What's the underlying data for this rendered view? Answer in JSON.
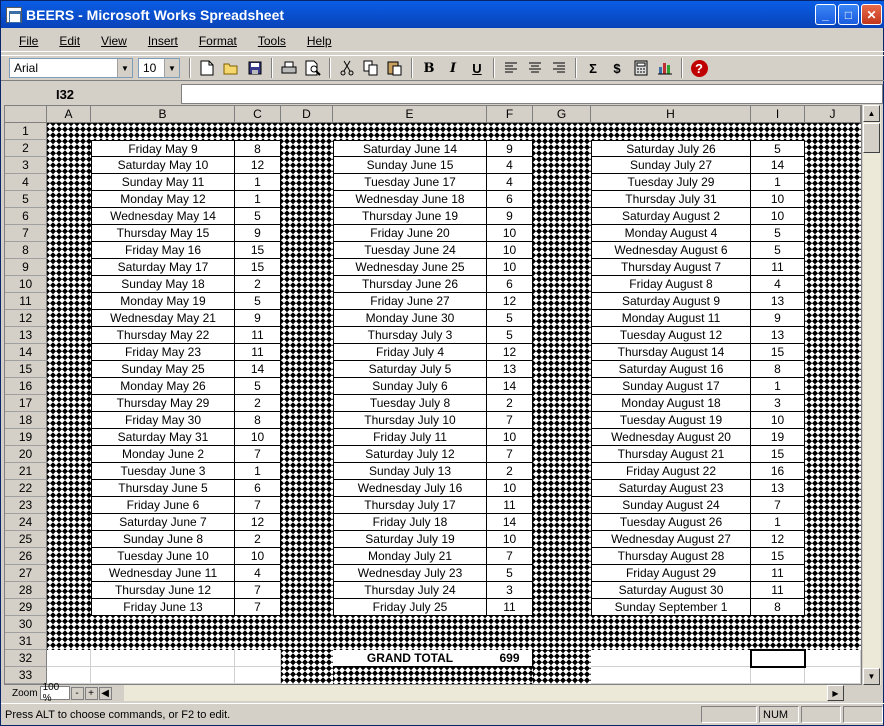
{
  "window": {
    "title": "BEERS - Microsoft Works Spreadsheet",
    "minimize": "_",
    "maximize": "□",
    "close": "✕"
  },
  "menu": [
    "File",
    "Edit",
    "View",
    "Insert",
    "Format",
    "Tools",
    "Help"
  ],
  "toolbar": {
    "font": "Arial",
    "size": "10",
    "icons": [
      "new-icon",
      "open-icon",
      "save-icon",
      "print-icon",
      "print-preview-icon",
      "cut-icon",
      "copy-icon",
      "paste-icon",
      "bold-icon",
      "italic-icon",
      "underline-icon",
      "align-left-icon",
      "align-center-icon",
      "align-right-icon",
      "autosum-icon",
      "currency-icon",
      "easy-calc-icon",
      "chart-icon",
      "help-icon"
    ],
    "bold": "B",
    "italic": "I",
    "underline": "U",
    "autosum": "Σ",
    "currency": "$",
    "help": "?"
  },
  "formula": {
    "cell_ref": "I32",
    "value": ""
  },
  "columns": [
    "A",
    "B",
    "C",
    "D",
    "E",
    "F",
    "G",
    "H",
    "I",
    "J"
  ],
  "rows": [
    "1",
    "2",
    "3",
    "4",
    "5",
    "6",
    "7",
    "8",
    "9",
    "10",
    "11",
    "12",
    "13",
    "14",
    "15",
    "16",
    "17",
    "18",
    "19",
    "20",
    "21",
    "22",
    "23",
    "24",
    "25",
    "26",
    "27",
    "28",
    "29",
    "30",
    "31",
    "32",
    "33"
  ],
  "data": {
    "block1": [
      [
        "Friday May 9",
        "8"
      ],
      [
        "Saturday May 10",
        "12"
      ],
      [
        "Sunday May 11",
        "1"
      ],
      [
        "Monday May 12",
        "1"
      ],
      [
        "Wednesday May 14",
        "5"
      ],
      [
        "Thursday May 15",
        "9"
      ],
      [
        "Friday May 16",
        "15"
      ],
      [
        "Saturday May 17",
        "15"
      ],
      [
        "Sunday May 18",
        "2"
      ],
      [
        "Monday May 19",
        "5"
      ],
      [
        "Wednesday May 21",
        "9"
      ],
      [
        "Thursday May 22",
        "11"
      ],
      [
        "Friday May 23",
        "11"
      ],
      [
        "Sunday May 25",
        "14"
      ],
      [
        "Monday May 26",
        "5"
      ],
      [
        "Thursday May 29",
        "2"
      ],
      [
        "Friday May 30",
        "8"
      ],
      [
        "Saturday May 31",
        "10"
      ],
      [
        "Monday June 2",
        "7"
      ],
      [
        "Tuesday June 3",
        "1"
      ],
      [
        "Thursday June 5",
        "6"
      ],
      [
        "Friday June 6",
        "7"
      ],
      [
        "Saturday June 7",
        "12"
      ],
      [
        "Sunday June 8",
        "2"
      ],
      [
        "Tuesday June 10",
        "10"
      ],
      [
        "Wednesday June 11",
        "4"
      ],
      [
        "Thursday June 12",
        "7"
      ],
      [
        "Friday June 13",
        "7"
      ]
    ],
    "block2": [
      [
        "Saturday June 14",
        "9"
      ],
      [
        "Sunday June 15",
        "4"
      ],
      [
        "Tuesday June 17",
        "4"
      ],
      [
        "Wednesday June 18",
        "6"
      ],
      [
        "Thursday June 19",
        "9"
      ],
      [
        "Friday June 20",
        "10"
      ],
      [
        "Tuesday June 24",
        "10"
      ],
      [
        "Wednesday June 25",
        "10"
      ],
      [
        "Thursday June 26",
        "6"
      ],
      [
        "Friday June 27",
        "12"
      ],
      [
        "Monday June 30",
        "5"
      ],
      [
        "Thursday July 3",
        "5"
      ],
      [
        "Friday July 4",
        "12"
      ],
      [
        "Saturday July 5",
        "13"
      ],
      [
        "Sunday July 6",
        "14"
      ],
      [
        "Tuesday July 8",
        "2"
      ],
      [
        "Thursday July 10",
        "7"
      ],
      [
        "Friday July 11",
        "10"
      ],
      [
        "Saturday July 12",
        "7"
      ],
      [
        "Sunday July 13",
        "2"
      ],
      [
        "Wednesday July 16",
        "10"
      ],
      [
        "Thursday July 17",
        "11"
      ],
      [
        "Friday July 18",
        "14"
      ],
      [
        "Saturday July 19",
        "10"
      ],
      [
        "Monday July 21",
        "7"
      ],
      [
        "Wednesday July 23",
        "5"
      ],
      [
        "Thursday July 24",
        "3"
      ],
      [
        "Friday July 25",
        "11"
      ]
    ],
    "block3": [
      [
        "Saturday July 26",
        "5"
      ],
      [
        "Sunday July 27",
        "14"
      ],
      [
        "Tuesday July 29",
        "1"
      ],
      [
        "Thursday July 31",
        "10"
      ],
      [
        "Saturday August 2",
        "10"
      ],
      [
        "Monday August 4",
        "5"
      ],
      [
        "Wednesday August 6",
        "5"
      ],
      [
        "Thursday August 7",
        "11"
      ],
      [
        "Friday August 8",
        "4"
      ],
      [
        "Saturday August 9",
        "13"
      ],
      [
        "Monday August 11",
        "9"
      ],
      [
        "Tuesday August 12",
        "13"
      ],
      [
        "Thursday August 14",
        "15"
      ],
      [
        "Saturday August 16",
        "8"
      ],
      [
        "Sunday August 17",
        "1"
      ],
      [
        "Monday August 18",
        "3"
      ],
      [
        "Tuesday August 19",
        "10"
      ],
      [
        "Wednesday August 20",
        "19"
      ],
      [
        "Thursday August 21",
        "15"
      ],
      [
        "Friday August 22",
        "16"
      ],
      [
        "Saturday August 23",
        "13"
      ],
      [
        "Sunday August 24",
        "7"
      ],
      [
        "Tuesday August 26",
        "1"
      ],
      [
        "Wednesday August 27",
        "12"
      ],
      [
        "Thursday August 28",
        "15"
      ],
      [
        "Friday August 29",
        "11"
      ],
      [
        "Saturday August 30",
        "11"
      ],
      [
        "Sunday September 1",
        "8"
      ]
    ]
  },
  "grand_total": {
    "label": "GRAND TOTAL",
    "value": "699"
  },
  "zoom": {
    "label": "Zoom",
    "value": "100 %",
    "minus": "-",
    "plus": "+"
  },
  "status": {
    "message": "Press ALT to choose commands, or F2 to edit.",
    "num": "NUM"
  }
}
